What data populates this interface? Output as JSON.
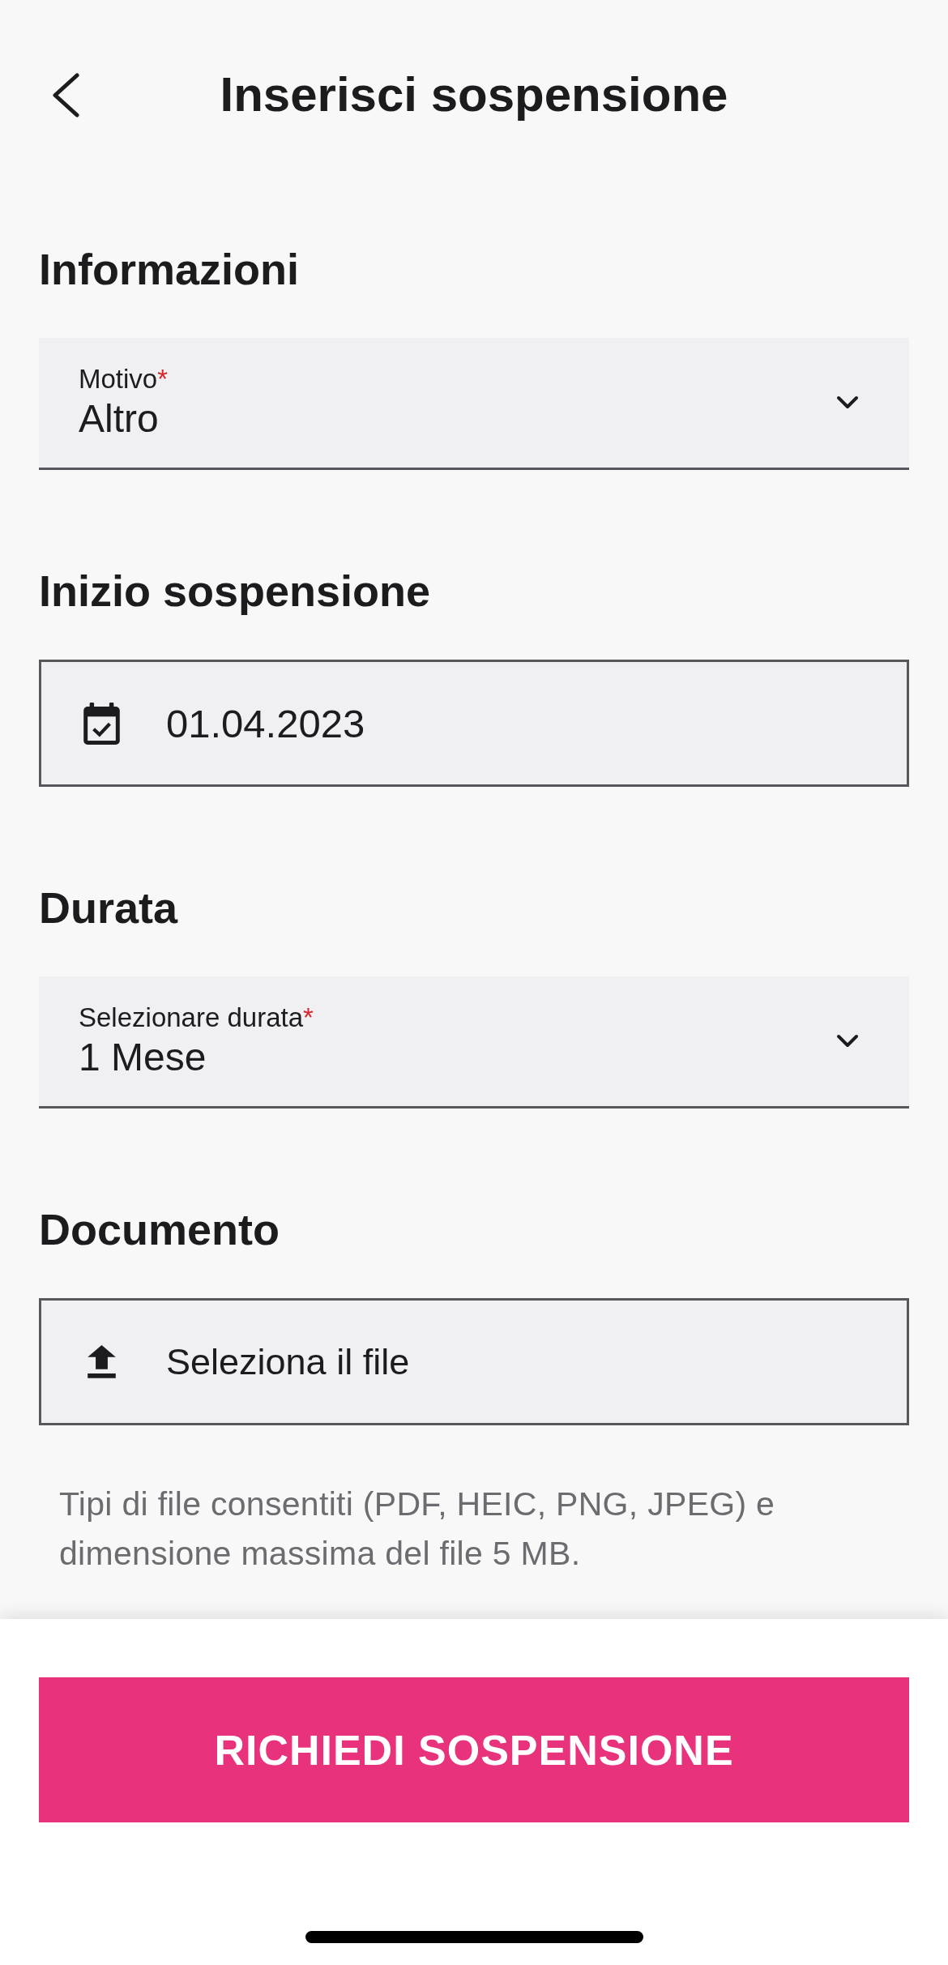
{
  "header": {
    "title": "Inserisci sospensione"
  },
  "sections": [
    {
      "heading": "Informazioni",
      "field": {
        "kind": "select",
        "label": "Motivo",
        "required_mark": "*",
        "value": "Altro"
      }
    },
    {
      "heading": "Inizio sospensione",
      "field": {
        "kind": "date",
        "value": "01.04.2023"
      }
    },
    {
      "heading": "Durata",
      "field": {
        "kind": "select",
        "label": "Selezionare durata",
        "required_mark": "*",
        "value": "1 Mese"
      }
    },
    {
      "heading": "Documento",
      "field": {
        "kind": "file",
        "label": "Seleziona il file"
      },
      "hint": "Tipi di file consentiti (PDF, HEIC, PNG, JPEG) e dimensione massima del file 5 MB."
    }
  ],
  "submit_button": {
    "label": "RICHIEDI SOSPENSIONE"
  }
}
